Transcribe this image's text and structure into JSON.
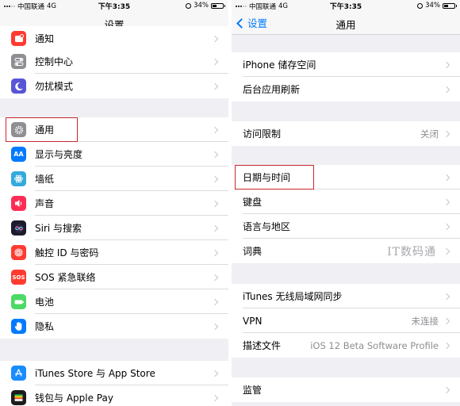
{
  "left": {
    "status": {
      "carrier": "中国联通",
      "network": "4G",
      "time": "下午3:35",
      "battery": "34%"
    },
    "title": "设置",
    "rows": [
      {
        "label": "通知",
        "icon": "notification-icon",
        "color": "#ff3b30"
      },
      {
        "label": "控制中心",
        "icon": "control-center-icon",
        "color": "#8e8e93"
      },
      {
        "label": "勿扰模式",
        "icon": "moon-icon",
        "color": "#5856d6"
      },
      {
        "label": "通用",
        "icon": "gear-icon",
        "color": "#8e8e93"
      },
      {
        "label": "显示与亮度",
        "icon": "display-brightness-icon",
        "color": "#007aff",
        "glyph": "AA"
      },
      {
        "label": "墙纸",
        "icon": "wallpaper-icon",
        "color": "#34aadc"
      },
      {
        "label": "声音",
        "icon": "speaker-icon",
        "color": "#ff2d55"
      },
      {
        "label": "Siri 与搜索",
        "icon": "siri-icon",
        "color": "#1c1c2e"
      },
      {
        "label": "触控 ID 与密码",
        "icon": "fingerprint-icon",
        "color": "#ff3b30"
      },
      {
        "label": "SOS 紧急联络",
        "icon": "sos-icon",
        "color": "#ff3b30",
        "glyph": "SOS"
      },
      {
        "label": "电池",
        "icon": "battery-icon",
        "color": "#4cd964"
      },
      {
        "label": "隐私",
        "icon": "hand-icon",
        "color": "#007aff"
      },
      {
        "label": "iTunes Store 与 App Store",
        "icon": "app-store-icon",
        "color": "#1a8cff"
      },
      {
        "label": "钱包与 Apple Pay",
        "icon": "wallet-icon",
        "color": "#1c1c1e"
      }
    ]
  },
  "right": {
    "status": {
      "carrier": "中国联通",
      "network": "4G",
      "time": "下午3:35",
      "battery": "34%"
    },
    "back_label": "设置",
    "title": "通用",
    "rows": [
      {
        "label": "iPhone 储存空间",
        "value": ""
      },
      {
        "label": "后台应用刷新",
        "value": ""
      },
      {
        "label": "访问限制",
        "value": "关闭"
      },
      {
        "label": "日期与时间",
        "value": ""
      },
      {
        "label": "键盘",
        "value": ""
      },
      {
        "label": "语言与地区",
        "value": ""
      },
      {
        "label": "词典",
        "value": ""
      },
      {
        "label": "iTunes 无线局域网同步",
        "value": ""
      },
      {
        "label": "VPN",
        "value": "未连接"
      },
      {
        "label": "描述文件",
        "value": "iOS 12 Beta Software Profile"
      },
      {
        "label": "监管",
        "value": ""
      }
    ]
  },
  "watermark": "IT数码通",
  "highlight_color": "#c8282e"
}
